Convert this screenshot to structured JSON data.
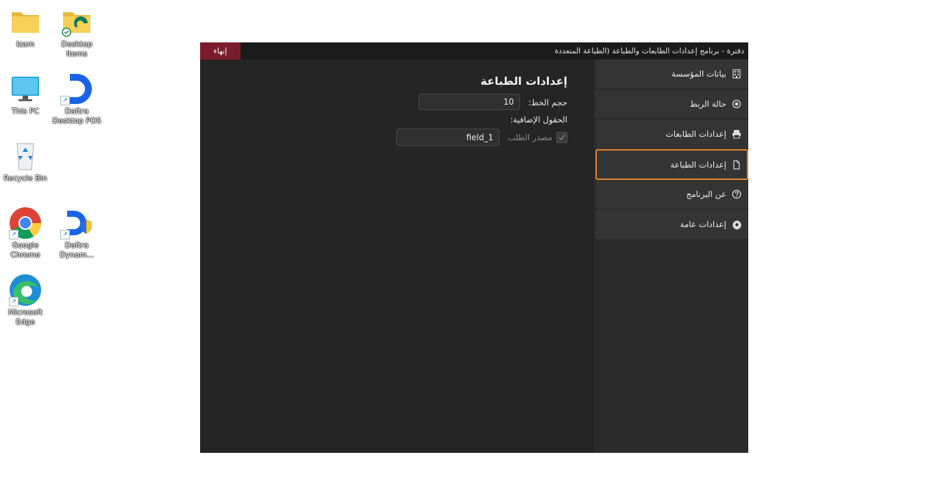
{
  "desktop": {
    "icons": [
      {
        "label": "Izam",
        "icon": "folder-icon"
      },
      {
        "label": "Desktop Items",
        "icon": "folder-synced-icon"
      },
      {
        "label": "This PC",
        "icon": "monitor-icon"
      },
      {
        "label": "Daftra Desktop POS",
        "icon": "daftra-icon"
      },
      {
        "label": "Recycle Bin",
        "icon": "recycle-bin-icon"
      },
      {
        "label": "Google Chrome",
        "icon": "chrome-icon"
      },
      {
        "label": "Daftra Dynam...",
        "icon": "daftra-dynamics-icon"
      },
      {
        "label": "Microsoft Edge",
        "icon": "edge-icon"
      }
    ]
  },
  "window": {
    "title": "دفترة - برنامج إعدادات الطابعات والطباعة (الطباعة المتعددة",
    "quit_label": "إنهاء",
    "accent_color": "#e8852b",
    "quit_color": "#7a1c2c"
  },
  "sidebar": {
    "items": [
      {
        "label": "بيانات المؤسسة",
        "icon": "building-icon",
        "active": false
      },
      {
        "label": "حالة الربط",
        "icon": "radio-dot-icon",
        "active": false
      },
      {
        "label": "إعدادات الطابعات",
        "icon": "printer-icon",
        "active": false
      },
      {
        "label": "إعدادات الطباعة",
        "icon": "document-icon",
        "active": true
      },
      {
        "label": "عن البرنامج",
        "icon": "help-icon",
        "active": false
      },
      {
        "label": "إعدادات عامة",
        "icon": "gear-icon",
        "active": false
      }
    ]
  },
  "content": {
    "title": "إعدادات الطباعة",
    "font_size_label": "حجم الخط:",
    "font_size_value": "10",
    "extra_fields_label": "الحقول الإضافية:",
    "request_source_label": "مصدر الطلب",
    "request_source_checked": true,
    "field_value": "field_1"
  }
}
